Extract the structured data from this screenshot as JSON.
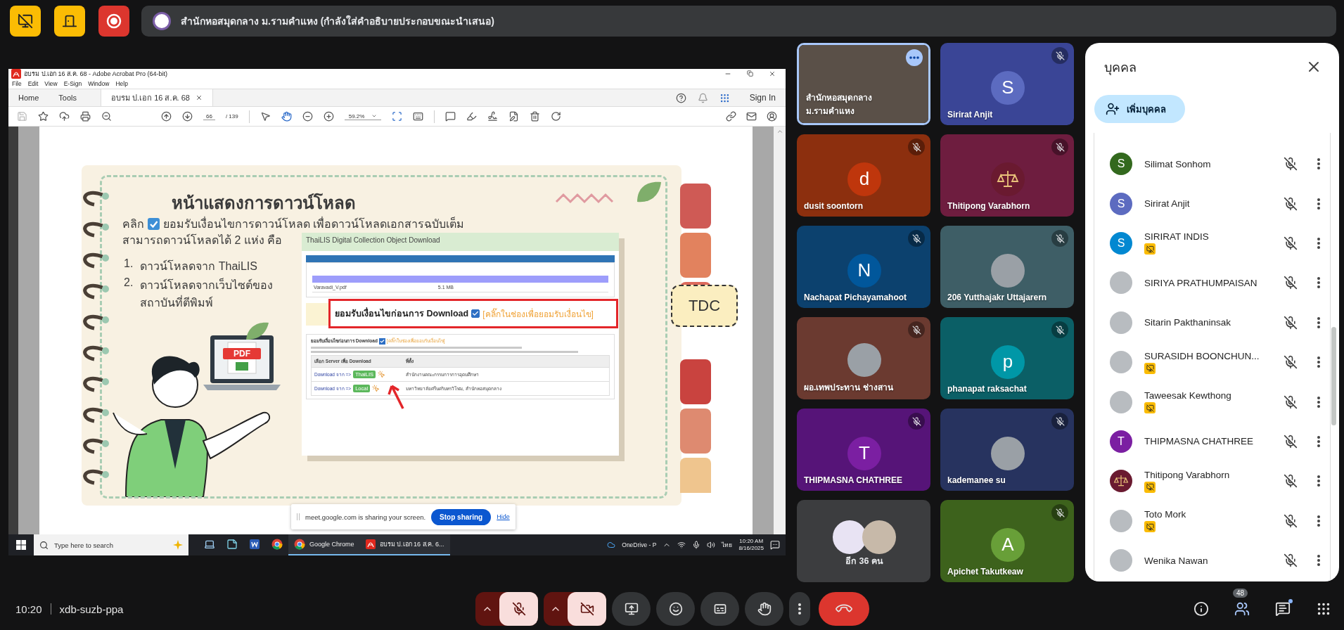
{
  "top_bar": {
    "buttons": [
      {
        "kind": "monitor-off"
      },
      {
        "kind": "door"
      },
      {
        "kind": "record"
      }
    ],
    "presenter": "สำนักหอสมุดกลาง ม.รามคำแหง (กำลังใส่คำอธิบายประกอบขณะนำเสนอ)"
  },
  "shared_screen": {
    "window_title": "อบรม ป.เอก 16 ส.ค. 68 - Adobe Acrobat Pro (64-bit)",
    "menu": [
      "File",
      "Edit",
      "View",
      "E-Sign",
      "Window",
      "Help"
    ],
    "tabs": [
      {
        "label": "Home",
        "selected": false
      },
      {
        "label": "Tools",
        "selected": false
      },
      {
        "label": "อบรม ป.เอก 16 ส.ค. 68",
        "selected": true
      }
    ],
    "sign_in": "Sign In",
    "page": "66",
    "page_total": "/ 139",
    "zoom": "59.2%",
    "slide": {
      "title": "หน้าแสดงการดาวน์โหลด",
      "intro_label": "คลิก",
      "intro_text": "ยอมรับเงื่อนไขการดาวน์โหลด เพื่อดาวน์โหลดเอกสารฉบับเต็ม",
      "intro_line2": "สามารถดาวน์โหลดได้ 2 แห่ง คือ",
      "steps": [
        {
          "number": "1.",
          "text": "ดาวน์โหลดจาก ThaiLIS"
        },
        {
          "number": "2.",
          "text": "ดาวน์โหลดจากเว็บไซต์ของสถาบันที่ตีพิมพ์"
        }
      ],
      "laptop_label": "PDF",
      "badge": "TDC",
      "web_page": {
        "header": "ThaiLIS Digital Collection Object Download",
        "file_name": "Varavadi_V.pdf",
        "file_size": "5.1 MB",
        "consent": "ยอมรับเงื่อนไขก่อนการ Download",
        "consent_hint": "[คลิ๊กในช่องเพื่อยอมรับเงื่อนไข]",
        "checked": true,
        "server_header": "เลือก Server เพื่อ Download",
        "location_header": "ที่ตั้ง",
        "servers": [
          {
            "prefix": "Download จาก =>",
            "button": "ThaiLIS",
            "location": "สำนักงานคณะกรรมการการอุดมศึกษา"
          },
          {
            "prefix": "Download จาก =>",
            "button": "Local",
            "location": "มหาวิทยาลัยศรีนครินทรวิโรฒ, สำนักหอสมุดกลาง"
          }
        ]
      },
      "callout": {
        "text": "ยอมรับเงื่อนไขก่อนการ Download",
        "hint": "[คลิ๊กในช่องเพื่อยอมรับเงื่อนไข]",
        "checked": true
      }
    },
    "share_notice": {
      "text": "meet.google.com is sharing your screen.",
      "stop": "Stop sharing",
      "hide": "Hide"
    },
    "taskbar": {
      "search_placeholder": "Type here to search",
      "apps": [
        {
          "kind": "computer",
          "open": false
        },
        {
          "kind": "notes",
          "open": false
        },
        {
          "kind": "word",
          "open": false
        },
        {
          "kind": "chrome",
          "open": false
        },
        {
          "kind": "chrome",
          "label": "Google Chrome",
          "open": true
        },
        {
          "kind": "acrobat",
          "label": "อบรม ป.เอก 16 ส.ค. 6...",
          "open": true
        }
      ],
      "tray_app": "OneDrive - P",
      "language": "ไทย",
      "time": "10:20 AM",
      "date": "8/16/2025"
    }
  },
  "tiles": [
    {
      "name": "สำนักหอสมุดกลาง ม.รามคำแหง",
      "kind": "video",
      "speaking": true,
      "muted": false,
      "color": "#5a5048"
    },
    {
      "name": "Sirirat Anjit",
      "kind": "initial",
      "initial": "S",
      "speaking": false,
      "muted": true,
      "color": "#3a4596",
      "avatar": {
        "color": "#5c6bc0"
      }
    },
    {
      "name": "dusit soontorn",
      "kind": "initial",
      "initial": "d",
      "speaking": false,
      "muted": true,
      "color": "#8c2f0e",
      "avatar": {
        "color": "#bf360c"
      }
    },
    {
      "name": "Thitipong Varabhorn",
      "kind": "logo",
      "speaking": false,
      "muted": true,
      "color": "#6e1d3f"
    },
    {
      "name": "Nachapat Pichayamahoot",
      "kind": "initial",
      "initial": "N",
      "speaking": false,
      "muted": true,
      "color": "#0c416e",
      "avatar": {
        "color": "#01579b"
      }
    },
    {
      "name": "206 Yutthajakr Uttajarern",
      "kind": "photo",
      "speaking": false,
      "muted": true,
      "color": "#3e5e66"
    },
    {
      "name": "ผอ.เทพประทาน ช่างสาน",
      "kind": "photo",
      "speaking": false,
      "muted": true,
      "color": "#6b3a30"
    },
    {
      "name": "phanapat raksachat",
      "kind": "initial",
      "initial": "p",
      "speaking": false,
      "muted": true,
      "color": "#0b5f66",
      "avatar": {
        "color": "#0097a7"
      }
    },
    {
      "name": "THIPMASNA CHATHREE",
      "kind": "initial",
      "initial": "T",
      "speaking": false,
      "muted": true,
      "color": "#561478",
      "avatar": {
        "color": "#7b1fa2"
      }
    },
    {
      "name": "kademanee su",
      "kind": "photo",
      "speaking": false,
      "muted": true,
      "color": "#27335f"
    },
    {
      "name": "อีก 36 คน",
      "kind": "overflow",
      "speaking": false,
      "muted": false,
      "color": "#3c3d3f"
    },
    {
      "name": "Apichet Takutkeaw",
      "kind": "initial",
      "initial": "A",
      "speaking": false,
      "muted": true,
      "color": "#3d621c",
      "avatar": {
        "color": "#689f38"
      }
    }
  ],
  "people_panel": {
    "title": "บุคคล",
    "add_button": "เพิ่มบุคคล",
    "people": [
      {
        "name": "Silimat Sonhom",
        "kind": "initial",
        "initial": "S",
        "color": "#33691e",
        "tagged": false
      },
      {
        "name": "Sirirat Anjit",
        "kind": "initial",
        "initial": "S",
        "color": "#5c6bc0",
        "tagged": false
      },
      {
        "name": "SIRIRAT INDIS",
        "kind": "initial",
        "initial": "S",
        "color": "#0288d1",
        "tagged": true
      },
      {
        "name": "SIRIYA PRATHUMPAISAN",
        "kind": "photo",
        "tagged": false
      },
      {
        "name": "Sitarin Pakthaninsak",
        "kind": "photo",
        "tagged": false
      },
      {
        "name": "SURASIDH BOONCHUN...",
        "kind": "photo",
        "tagged": true
      },
      {
        "name": "Taweesak Kewthong",
        "kind": "photo",
        "tagged": true
      },
      {
        "name": "THIPMASNA CHATHREE",
        "kind": "initial",
        "initial": "T",
        "color": "#7b1fa2",
        "tagged": false
      },
      {
        "name": "Thitipong Varabhorn",
        "kind": "logo",
        "tagged": true
      },
      {
        "name": "Toto Mork",
        "kind": "photo",
        "tagged": true
      },
      {
        "name": "Wenika Nawan",
        "kind": "photo",
        "tagged": false
      }
    ]
  },
  "bottom_bar": {
    "time": "10:20",
    "code": "xdb-suzb-ppa",
    "controls": [
      {
        "kind": "mic",
        "on": false
      },
      {
        "kind": "camera",
        "on": false
      },
      {
        "kind": "present"
      },
      {
        "kind": "emoji"
      },
      {
        "kind": "captions"
      },
      {
        "kind": "hand"
      },
      {
        "kind": "more"
      },
      {
        "kind": "leave"
      }
    ],
    "side": [
      {
        "kind": "info"
      },
      {
        "kind": "people",
        "count": "48"
      },
      {
        "kind": "chat",
        "unread": true
      },
      {
        "kind": "apps"
      }
    ]
  }
}
